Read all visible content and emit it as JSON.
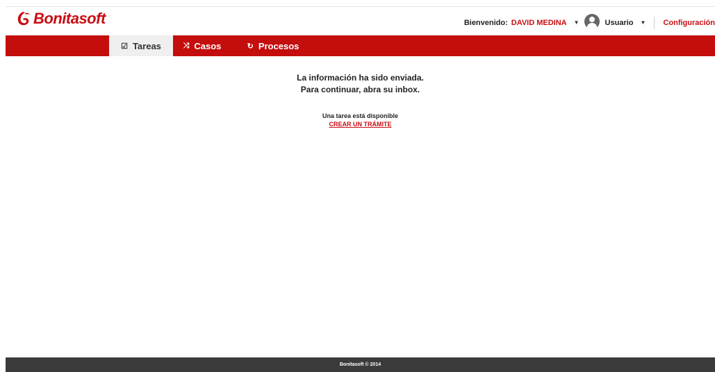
{
  "brand": {
    "name": "Bonitasoft",
    "color": "#c90d12"
  },
  "header": {
    "welcome_label": "Bienvenido:",
    "user_name": "DAVID MEDINA",
    "role_label": "Usuario",
    "settings_label": "Configuración"
  },
  "nav": {
    "tabs": [
      {
        "label": "Tareas",
        "icon": "checkbox-icon",
        "active": true
      },
      {
        "label": "Casos",
        "icon": "shuffle-icon",
        "active": false
      },
      {
        "label": "Procesos",
        "icon": "process-icon",
        "active": false
      }
    ]
  },
  "main": {
    "message_line1": "La información ha sido enviada.",
    "message_line2": "Para continuar, abra su inbox.",
    "task_note": "Una tarea está disponible",
    "task_link": "CREAR UN TRÁMITE"
  },
  "footer": {
    "text": "Bonitasoft © 2014"
  },
  "colors": {
    "accent": "#c40d0d",
    "footer_bg": "#3b3b3b"
  }
}
